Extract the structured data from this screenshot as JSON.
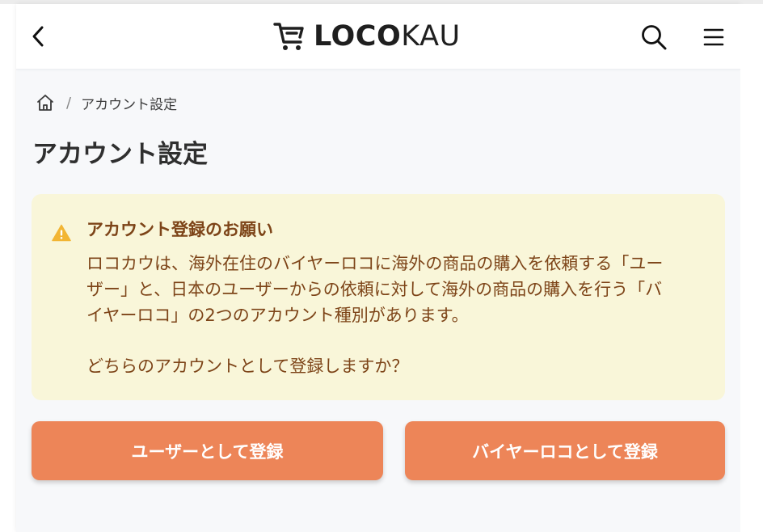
{
  "header": {
    "logo_bold": "LOCO",
    "logo_light": "KAU",
    "icons": {
      "back": "chevron-left-icon",
      "logo": "cart-icon",
      "search": "search-icon",
      "menu": "hamburger-menu-icon"
    }
  },
  "breadcrumb": {
    "home_icon": "home-icon",
    "separator": "/",
    "current": "アカウント設定"
  },
  "page": {
    "title": "アカウント設定"
  },
  "notice": {
    "icon": "warning-icon",
    "title": "アカウント登録のお願い",
    "body_lines": [
      "ロコカウは、海外在住のバイヤーロコに海外の商品の購入を依頼する「ユー",
      "ザー」と、日本のユーザーからの依頼に対して海外の商品の購入を行う「バ",
      "イヤーロコ」の2つのアカウント種別があります。"
    ],
    "question": "どちらのアカウントとして登録しますか？"
  },
  "actions": {
    "register_user": "ユーザーとして登録",
    "register_buyer": "バイヤーロコとして登録"
  },
  "colors": {
    "accent_button": "#ed8558",
    "notice_bg": "#f9f6d9",
    "notice_text": "#7d4418",
    "warning_icon": "#f2b534"
  }
}
